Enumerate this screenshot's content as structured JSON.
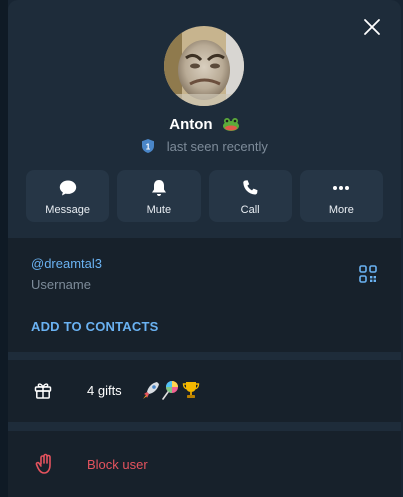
{
  "profile": {
    "name": "Anton",
    "name_emoji": "frog-emoji",
    "status": "last seen recently",
    "status_badge": "1",
    "avatar": "photo"
  },
  "actions": [
    {
      "label": "Message",
      "icon": "message-icon"
    },
    {
      "label": "Mute",
      "icon": "bell-icon"
    },
    {
      "label": "Call",
      "icon": "phone-icon"
    },
    {
      "label": "More",
      "icon": "more-icon"
    }
  ],
  "info": {
    "username": "@dreamtal3",
    "username_caption": "Username",
    "add_to_contacts": "ADD TO CONTACTS"
  },
  "gifts": {
    "label": "4 gifts",
    "icons": [
      "rocket-icon",
      "lollipop-icon",
      "trophy-icon"
    ]
  },
  "block": {
    "label": "Block user"
  },
  "colors": {
    "accent": "#6ab2f2",
    "danger": "#e5535e",
    "panel": "#1e2c3a",
    "section": "#17212b"
  }
}
